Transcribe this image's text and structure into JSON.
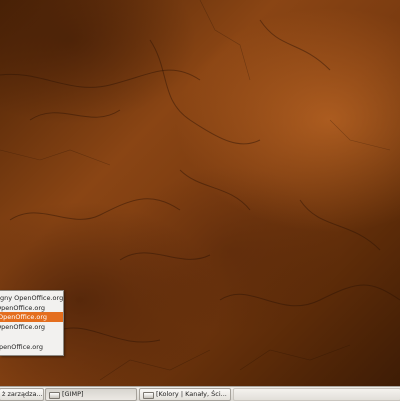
{
  "menu": {
    "items": [
      {
        "label": "gny OpenOffice.org",
        "selected": false
      },
      {
        "label": "OpenOffice.org",
        "selected": false
      },
      {
        "label": "OpenOffice.org",
        "selected": true
      },
      {
        "label": "OpenOffice.org",
        "selected": false
      },
      {
        "label": "penOffice.org",
        "selected": false
      }
    ]
  },
  "taskbar": {
    "tasks": [
      {
        "label": "ż zarządza...",
        "icon": "window-icon"
      },
      {
        "label": "[GIMP]",
        "icon": "window-icon"
      },
      {
        "label": "[Kolory | Kanały, Ści...",
        "icon": "window-icon"
      },
      {
        "label": "",
        "icon": ""
      }
    ]
  },
  "colors": {
    "accent": "#e46e1e",
    "taskbar": "#e6e3de",
    "wallpaper": "#7a3b10"
  }
}
